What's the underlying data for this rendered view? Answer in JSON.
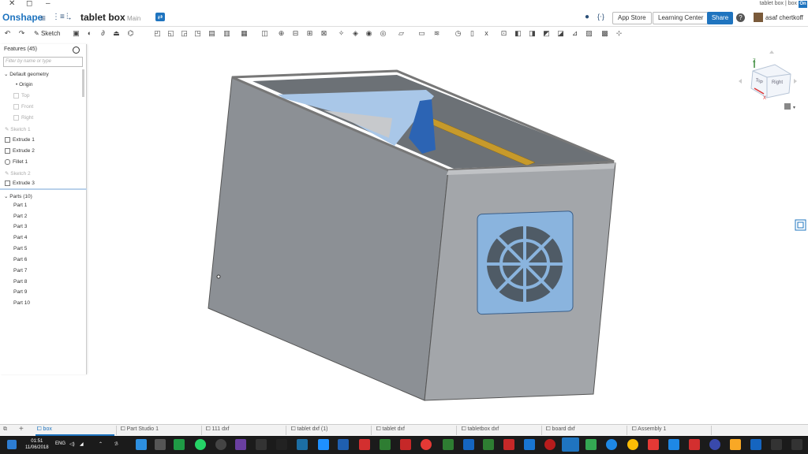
{
  "window": {
    "title": "tablet box | box",
    "badge": "On"
  },
  "header": {
    "logo": "Onshape",
    "doc_title": "tablet box",
    "branch": "Main",
    "app_store": "App Store",
    "learning_center": "Learning Center",
    "share": "Share",
    "user": "asaf chertkoff"
  },
  "toolbar": {
    "sketch_label": "Sketch"
  },
  "panel": {
    "title": "Features (45)",
    "filter_placeholder": "Filter by name or type",
    "default_geometry": "Default geometry",
    "items": [
      {
        "label": "Origin",
        "dim": false
      },
      {
        "label": "Top",
        "dim": true
      },
      {
        "label": "Front",
        "dim": true
      },
      {
        "label": "Right",
        "dim": true
      },
      {
        "label": "Sketch 1",
        "dim": true
      },
      {
        "label": "Extrude 1",
        "dim": false
      },
      {
        "label": "Extrude 2",
        "dim": false
      },
      {
        "label": "Fillet 1",
        "dim": false
      },
      {
        "label": "Sketch 2",
        "dim": true
      },
      {
        "label": "Extrude 3",
        "dim": false
      }
    ],
    "parts_header": "Parts (10)",
    "parts": [
      "Part 1",
      "Part 2",
      "Part 3",
      "Part 4",
      "Part 5",
      "Part 6",
      "Part 7",
      "Part 8",
      "Part 9",
      "Part 10"
    ]
  },
  "viewcube": {
    "top": "Top",
    "right": "Right",
    "x": "X",
    "z": "Z"
  },
  "tabs": [
    {
      "label": "box",
      "active": true
    },
    {
      "label": "Part Studio 1",
      "active": false
    },
    {
      "label": "111 dxf",
      "active": false
    },
    {
      "label": "tablet dxf (1)",
      "active": false
    },
    {
      "label": "tablet dxf",
      "active": false
    },
    {
      "label": "tabletbox dxf",
      "active": false
    },
    {
      "label": "board dxf",
      "active": false
    },
    {
      "label": "Assembly 1",
      "active": false
    }
  ],
  "taskbar": {
    "time": "01:51",
    "date": "11/06/2018",
    "lang": "ENG"
  },
  "colors": {
    "accent": "#1f74bf",
    "box_gray": "#8e9297",
    "fan_blue": "#8ab4de",
    "part_blue": "#2c64b4",
    "part_gold": "#c79a2b"
  }
}
